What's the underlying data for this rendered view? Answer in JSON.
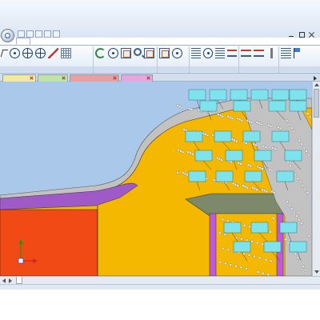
{
  "window": {
    "title": "",
    "app_icon": "app-orb-icon",
    "quick_access_icons": [
      "new-icon",
      "open-icon",
      "save-icon",
      "undo-icon",
      "redo-icon"
    ],
    "controls": [
      "minimize-icon",
      "maximize-icon",
      "close-icon"
    ]
  },
  "ribbon": {
    "tabs": [
      {
        "label": "",
        "active": true
      },
      {
        "label": ""
      },
      {
        "label": ""
      },
      {
        "label": ""
      },
      {
        "label": ""
      },
      {
        "label": ""
      },
      {
        "label": ""
      },
      {
        "label": ""
      }
    ],
    "groups": [
      {
        "label": "",
        "icons": [
          "select-icon",
          "circle-icon",
          "target-icon",
          "target-icon",
          "pen-icon",
          "grid-icon"
        ]
      },
      {
        "label": "",
        "icons": [
          "refresh-icon",
          "circle-icon",
          "box-icon",
          "magnifier-icon",
          "box-icon"
        ]
      },
      {
        "label": "",
        "icons": [
          "box-icon",
          "circle-icon"
        ]
      },
      {
        "label": "",
        "icons": [
          "bars-icon",
          "circle-icon",
          "bars-icon",
          "lines-icon"
        ]
      },
      {
        "label": "",
        "icons": [
          "lines-icon",
          "lines-icon",
          "pin-icon"
        ]
      },
      {
        "label": "",
        "icons": [
          "bars-icon",
          "flag-icon"
        ]
      }
    ]
  },
  "document_tabs": [
    {
      "label": "",
      "color": "#f3e9a0",
      "active": false
    },
    {
      "label": "",
      "color": "#bfe3a8",
      "active": false
    },
    {
      "label": "",
      "color": "#e8a0a0",
      "active": true
    },
    {
      "label": "",
      "color": "#e6a7dc",
      "active": false
    }
  ],
  "viewport": {
    "background": "#a9c8ea",
    "info_text": [
      "",
      "",
      "",
      "",
      "",
      ""
    ],
    "cyan_labels": [
      {
        "l1": "",
        "l2": ""
      },
      {
        "l1": "",
        "l2": ""
      },
      {
        "l1": "",
        "l2": ""
      },
      {
        "l1": "",
        "l2": ""
      },
      {
        "l1": "",
        "l2": ""
      },
      {
        "l1": "",
        "l2": ""
      },
      {
        "l1": "",
        "l2": ""
      },
      {
        "l1": "",
        "l2": ""
      },
      {
        "l1": "",
        "l2": ""
      },
      {
        "l1": "",
        "l2": ""
      },
      {
        "l1": "",
        "l2": ""
      },
      {
        "l1": "",
        "l2": ""
      },
      {
        "l1": "",
        "l2": ""
      },
      {
        "l1": "",
        "l2": ""
      },
      {
        "l1": "",
        "l2": ""
      },
      {
        "l1": "",
        "l2": ""
      },
      {
        "l1": "",
        "l2": ""
      },
      {
        "l1": "",
        "l2": ""
      },
      {
        "l1": "",
        "l2": ""
      },
      {
        "l1": "",
        "l2": ""
      },
      {
        "l1": "",
        "l2": ""
      },
      {
        "l1": "",
        "l2": ""
      },
      {
        "l1": "",
        "l2": ""
      },
      {
        "l1": "",
        "l2": ""
      },
      {
        "l1": "",
        "l2": ""
      },
      {
        "l1": "",
        "l2": ""
      },
      {
        "l1": "",
        "l2": ""
      },
      {
        "l1": "",
        "l2": ""
      }
    ],
    "axis_icon": "coordinate-axes-icon",
    "colors": {
      "yellow_region": "#f5b800",
      "orange_region": "#f24a14",
      "purple_band": "#9f5ac8",
      "gray_boundary": "#c2c2c2",
      "green_platform": "#7c8a6a",
      "magenta_strip": "#c05ad8",
      "cyan_label": "#7fe3ee",
      "pile_marker": "#e8edf4"
    }
  },
  "bottom_bar": {
    "sheet_tabs": [
      {
        "label": "",
        "active": true
      },
      {
        "label": ""
      }
    ]
  }
}
